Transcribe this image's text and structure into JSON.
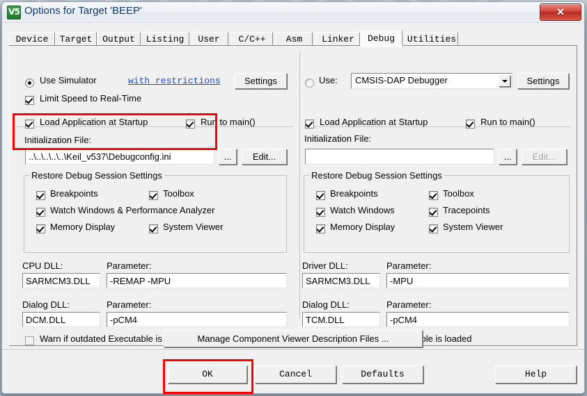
{
  "window": {
    "title": "Options for Target 'BEEP'",
    "icon": "keil-uvision-icon",
    "icon_glyph": "V5",
    "close_label": "✕"
  },
  "tabs": [
    {
      "label": "Device",
      "selected": false
    },
    {
      "label": "Target",
      "selected": false
    },
    {
      "label": "Output",
      "selected": false
    },
    {
      "label": "Listing",
      "selected": false
    },
    {
      "label": "User",
      "selected": false
    },
    {
      "label": "C/C++",
      "selected": false
    },
    {
      "label": "Asm",
      "selected": false
    },
    {
      "label": "Linker",
      "selected": false
    },
    {
      "label": "Debug",
      "selected": true
    },
    {
      "label": "Utilities",
      "selected": false
    }
  ],
  "left": {
    "use_simulator_label": "Use Simulator",
    "use_simulator_checked": true,
    "with_restrictions_link": "with restrictions",
    "settings_label": "Settings",
    "limit_speed_label": "Limit Speed to Real-Time",
    "limit_speed_checked": true,
    "load_app_label": "Load Application at Startup",
    "load_app_checked": true,
    "run_to_main_label": "Run to main()",
    "run_to_main_checked": true,
    "init_file_label": "Initialization File:",
    "init_file_value": "..\\..\\..\\..\\..\\Keil_v537\\Debugconfig.ini",
    "browse_label": "...",
    "edit_label": "Edit...",
    "restore_group_title": "Restore Debug Session Settings",
    "restore_items": [
      {
        "label": "Breakpoints",
        "checked": true
      },
      {
        "label": "Toolbox",
        "checked": true
      },
      {
        "label": "Watch Windows & Performance Analyzer",
        "checked": true
      },
      {
        "label": "Memory Display",
        "checked": true
      },
      {
        "label": "System Viewer",
        "checked": true
      }
    ],
    "cpu_dll_label": "CPU DLL:",
    "cpu_dll_value": "SARMCM3.DLL",
    "cpu_param_label": "Parameter:",
    "cpu_param_value": "-REMAP -MPU",
    "dialog_dll_label": "Dialog DLL:",
    "dialog_dll_value": "DCM.DLL",
    "dialog_param_label": "Parameter:",
    "dialog_param_value": "-pCM4",
    "warn_label": "Warn if outdated Executable is loaded",
    "warn_checked": false
  },
  "right": {
    "use_label": "Use:",
    "use_checked": false,
    "debugger_value": "CMSIS-DAP Debugger",
    "settings_label": "Settings",
    "load_app_label": "Load Application at Startup",
    "load_app_checked": true,
    "run_to_main_label": "Run to main()",
    "run_to_main_checked": true,
    "init_file_label": "Initialization File:",
    "init_file_value": "",
    "browse_label": "...",
    "edit_label": "Edit...",
    "restore_group_title": "Restore Debug Session Settings",
    "restore_items": [
      {
        "label": "Breakpoints",
        "checked": true
      },
      {
        "label": "Toolbox",
        "checked": true
      },
      {
        "label": "Watch Windows",
        "checked": true
      },
      {
        "label": "Tracepoints",
        "checked": true
      },
      {
        "label": "Memory Display",
        "checked": true
      },
      {
        "label": "System Viewer",
        "checked": true
      }
    ],
    "driver_dll_label": "Driver DLL:",
    "driver_dll_value": "SARMCM3.DLL",
    "driver_param_label": "Parameter:",
    "driver_param_value": "-MPU",
    "dialog_dll_label": "Dialog DLL:",
    "dialog_dll_value": "TCM.DLL",
    "dialog_param_label": "Parameter:",
    "dialog_param_value": "-pCM4",
    "warn_label": "Warn if outdated Executable is loaded",
    "warn_checked": false
  },
  "footer": {
    "manage_label": "Manage Component Viewer Description Files ...",
    "ok_label": "OK",
    "cancel_label": "Cancel",
    "defaults_label": "Defaults",
    "help_label": "Help"
  },
  "annotations": {
    "highlight_color": "#ff0000",
    "regions": [
      "initialization-file-row",
      "ok-button"
    ]
  }
}
